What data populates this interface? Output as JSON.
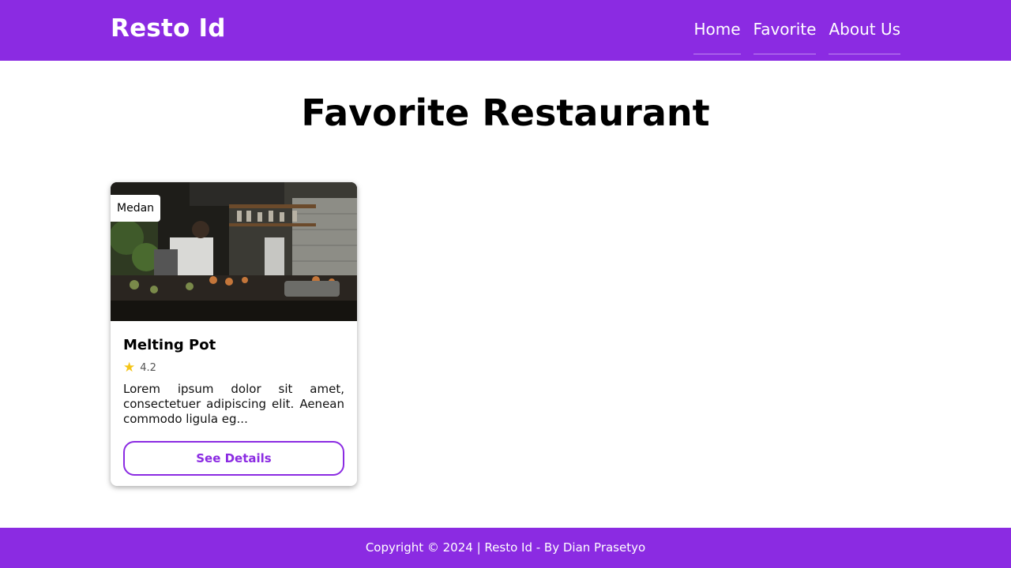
{
  "navbar": {
    "brand": "Resto Id",
    "links": [
      {
        "label": "Home"
      },
      {
        "label": "Favorite"
      },
      {
        "label": "About Us"
      }
    ]
  },
  "main": {
    "title": "Favorite Restaurant",
    "restaurants": [
      {
        "city": "Medan",
        "name": "Melting Pot",
        "rating": "4.2",
        "description": "Lorem ipsum dolor sit amet, consectetuer adipiscing elit. Aenean commodo ligula eg...",
        "button_label": "See Details"
      }
    ]
  },
  "footer": {
    "text": "Copyright © 2024 | Resto Id - By Dian Prasetyo"
  },
  "colors": {
    "brand_purple": "#8b2be2",
    "star": "#f5c518"
  },
  "icons": {
    "rating": "star-icon"
  }
}
